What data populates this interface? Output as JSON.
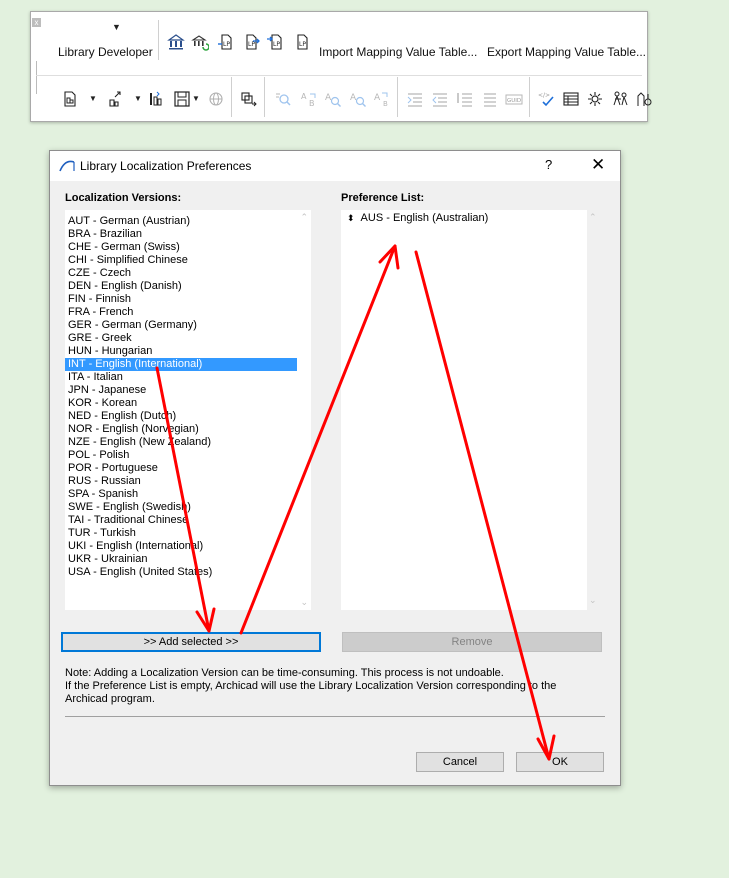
{
  "toolbar": {
    "library_dropdown_label": "Library Developer",
    "import_label": "Import Mapping Value Table...",
    "export_label": "Export Mapping Value Table...",
    "row1_icons": [
      "library-manager-icon",
      "library-reload-icon",
      "lp-convert-icon",
      "lp-export-icon",
      "lp-import-icon",
      "lp-refresh-icon"
    ],
    "row2_icons": [
      "new-object-icon",
      "open-object-icon",
      "component-icon",
      "save-object-icon",
      "globe-icon",
      "library-object-browser-icon",
      "find-icon",
      "replace-icon",
      "find-param-icon",
      "find-subtype-icon",
      "find-replace-icon",
      "indent-icon",
      "outdent-icon",
      "comment-icon",
      "uncomment-icon",
      "guid-icon",
      "check-script-icon",
      "table-icon",
      "settings-icon",
      "figures-icon",
      "graphics-icon"
    ]
  },
  "dialog": {
    "title": "Library Localization Preferences",
    "help_label": "?",
    "close_label": "✕",
    "localization_label": "Localization Versions:",
    "preference_label": "Preference List:",
    "localization_versions": [
      "AUT - German (Austrian)",
      "BRA - Brazilian",
      "CHE - German (Swiss)",
      "CHI - Simplified Chinese",
      "CZE - Czech",
      "DEN - English (Danish)",
      "FIN - Finnish",
      "FRA - French",
      "GER - German (Germany)",
      "GRE - Greek",
      "HUN - Hungarian",
      "INT - English (International)",
      "ITA - Italian",
      "JPN - Japanese",
      "KOR - Korean",
      "NED - English (Dutch)",
      "NOR - English (Norvegian)",
      "NZE - English (New Zealand)",
      "POL - Polish",
      "POR - Portuguese",
      "RUS - Russian",
      "SPA - Spanish",
      "SWE - English (Swedish)",
      "TAI - Traditional Chinese",
      "TUR - Turkish",
      "UKI - English (International)",
      "UKR - Ukrainian",
      "USA - English (United States)"
    ],
    "selected_version": "INT - English (International)",
    "preference_list": [
      "AUS - English (Australian)"
    ],
    "add_selected_label": ">> Add selected >>",
    "remove_label": "Remove",
    "note_line1": "Note: Adding a Localization Version can be time-consuming. This process is not undoable.",
    "note_line2": "If the Preference List is empty, Archicad will use the Library Localization Version corresponding to the",
    "note_line3": "Archicad program.",
    "cancel_label": "Cancel",
    "ok_label": "OK"
  },
  "colors": {
    "background": "#e2f1de",
    "selection": "#3399ff",
    "annotation_arrow": "#ff0000",
    "default_button_border": "#0078d7"
  }
}
